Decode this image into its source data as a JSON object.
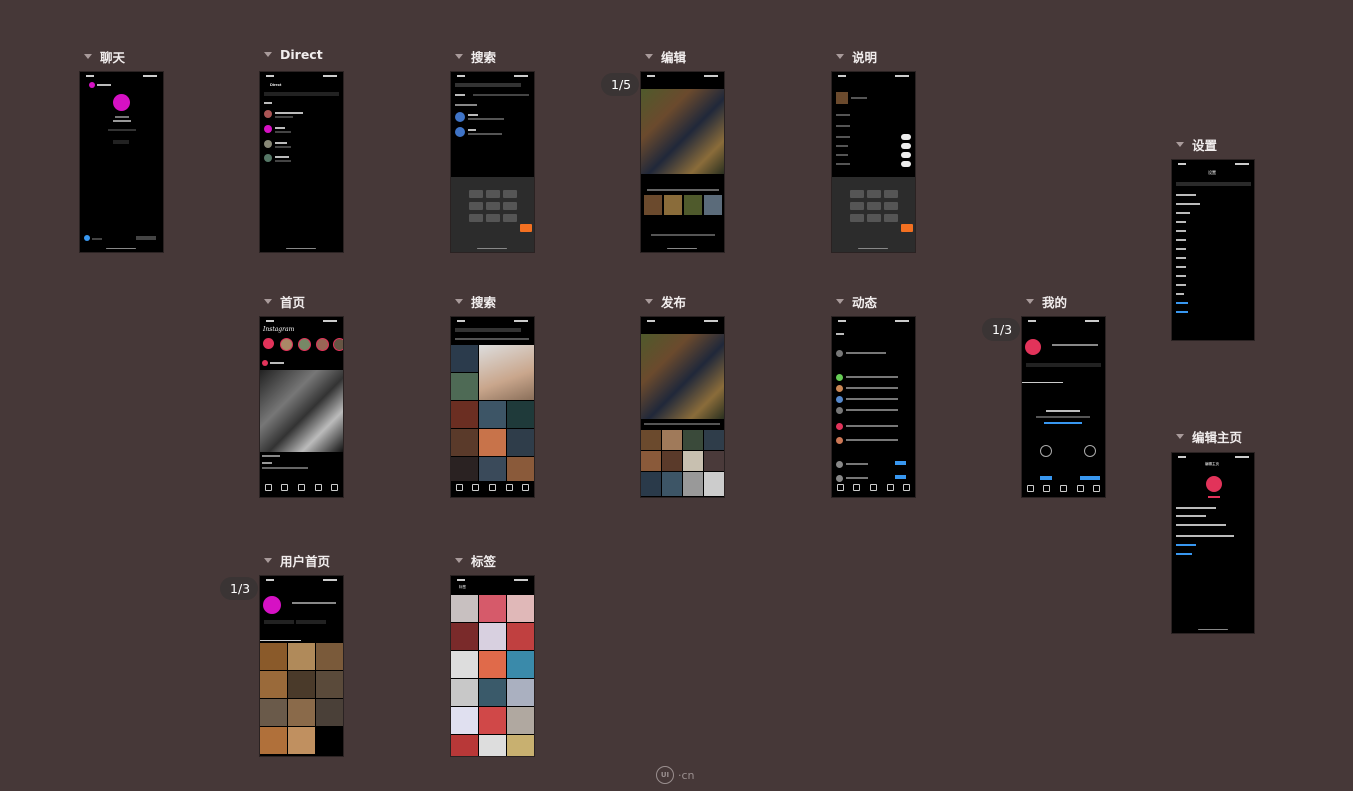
{
  "frames": {
    "chat": "聊天",
    "direct": "Direct",
    "search1": "搜索",
    "edit": "编辑",
    "caption": "说明",
    "settings": "设置",
    "home": "首页",
    "search2": "搜索",
    "publish": "发布",
    "activity": "动态",
    "mine": "我的",
    "edit_profile": "编辑主页",
    "user_home": "用户首页",
    "tags": "标签"
  },
  "badges": {
    "edit": "1/5",
    "mine": "1/3",
    "user_home": "1/3"
  },
  "phone_text": {
    "direct_title": "Direct",
    "home_logo": "Instagram",
    "edit_profile_title": "编辑主页",
    "settings_title": "设置",
    "tags_title": "标签"
  },
  "watermark": {
    "logo": "UI",
    "text": "·cn"
  },
  "colors": {
    "background": "#463838",
    "accent_pink": "#d611c4",
    "accent_blue": "#3897f0",
    "accent_orange": "#f37021"
  }
}
